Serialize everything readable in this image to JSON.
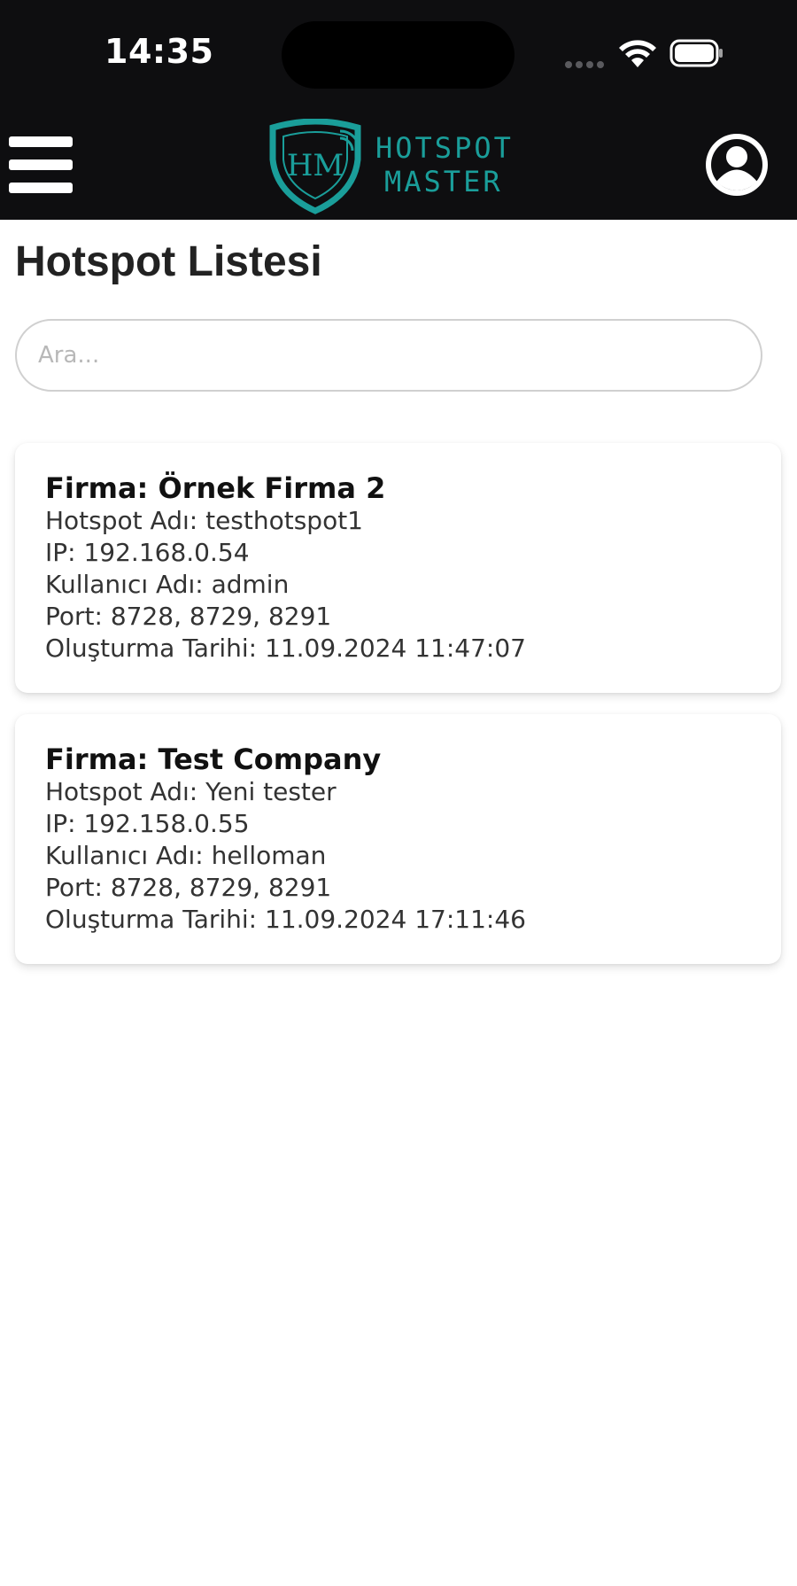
{
  "status_bar": {
    "time": "14:35"
  },
  "header": {
    "menu_icon": "hamburger-menu-icon",
    "logo": {
      "monogram": "HM",
      "line1": "HOTSPOT",
      "line2": "MASTER",
      "color": "#1a9e9a"
    },
    "profile_icon": "user-circle-icon"
  },
  "page": {
    "title": "Hotspot Listesi"
  },
  "search": {
    "placeholder": "Ara..."
  },
  "hotspots": [
    {
      "firma": "Firma: Örnek Firma 2",
      "hotspot_adi": "Hotspot Adı: testhotspot1",
      "ip": "IP: 192.168.0.54",
      "kullanici_adi": "Kullanıcı Adı: admin",
      "port": "Port: 8728, 8729, 8291",
      "olusturma_tarihi": "Oluşturma Tarihi: 11.09.2024 11:47:07"
    },
    {
      "firma": "Firma: Test Company",
      "hotspot_adi": "Hotspot Adı: Yeni tester",
      "ip": "IP: 192.158.0.55",
      "kullanici_adi": "Kullanıcı Adı: helloman",
      "port": "Port: 8728, 8729, 8291",
      "olusturma_tarihi": "Oluşturma Tarihi: 11.09.2024 17:11:46"
    }
  ]
}
